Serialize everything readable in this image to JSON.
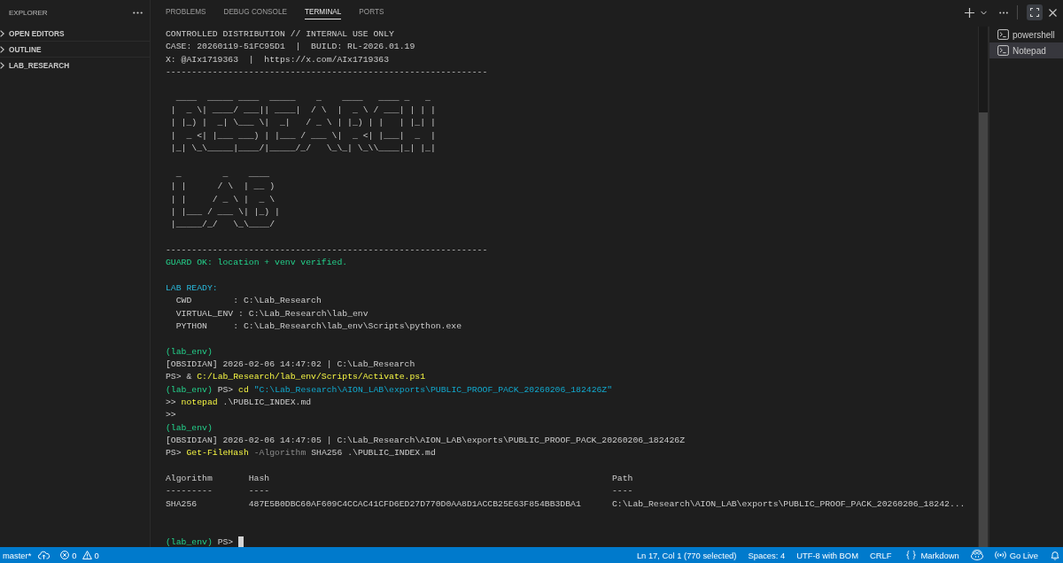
{
  "sidebar": {
    "title": "EXPLORER",
    "sections": [
      {
        "label": "OPEN EDITORS",
        "expanded": false
      },
      {
        "label": "OUTLINE",
        "expanded": false
      },
      {
        "label": "LAB_RESEARCH",
        "expanded": false
      }
    ]
  },
  "panel": {
    "tabs": [
      {
        "label": "PROBLEMS",
        "selected": false
      },
      {
        "label": "DEBUG CONSOLE",
        "selected": false
      },
      {
        "label": "TERMINAL",
        "selected": true
      },
      {
        "label": "PORTS",
        "selected": false
      }
    ]
  },
  "terminal": {
    "lines": [
      {
        "kind": "text",
        "segments": [
          {
            "kind": "plain",
            "text": "CONTROLLED DISTRIBUTION // INTERNAL USE ONLY"
          }
        ]
      },
      {
        "kind": "text",
        "segments": [
          {
            "kind": "plain",
            "text": "CASE: 20260119-51FC95D1  |  BUILD: RL-2026.01.19"
          }
        ]
      },
      {
        "kind": "text",
        "segments": [
          {
            "kind": "plain",
            "text": "X: @AIx1719363  |  https://x.com/AIx1719363"
          }
        ]
      },
      {
        "kind": "text",
        "segments": [
          {
            "kind": "plain",
            "text": "--------------------------------------------------------------"
          }
        ]
      },
      {
        "kind": "blank"
      },
      {
        "kind": "banner",
        "art": [
          " ____  _____ ____  _____    _    ____   ____ _   _",
          "|  _ \\| ____/ ___|| ____|  / \\  |  _ \\ / ___| | | |",
          "| |_) |  _| \\___ \\|  _|   / _ \\ | |_) | |   | |_| |",
          "|  _ <| |___ ___) | |___ / ___ \\|  _ <| |___|  _  |",
          "|_| \\_\\_____|____/|_____/_/   \\_\\_| \\_\\\\____|_| |_|"
        ]
      },
      {
        "kind": "blank"
      },
      {
        "kind": "banner",
        "art": [
          " _        _    ____",
          "| |      / \\  | __ )",
          "| |     / _ \\ |  _ \\",
          "| |___ / ___ \\| |_) |",
          "|_____/_/   \\_\\____/"
        ]
      },
      {
        "kind": "blank"
      },
      {
        "kind": "text",
        "segments": [
          {
            "kind": "plain",
            "text": "--------------------------------------------------------------"
          }
        ]
      },
      {
        "kind": "text",
        "segments": [
          {
            "kind": "success",
            "text": "GUARD OK: location + venv verified."
          }
        ]
      },
      {
        "kind": "blank"
      },
      {
        "kind": "text",
        "segments": [
          {
            "kind": "heading",
            "text": "LAB READY:"
          }
        ]
      },
      {
        "kind": "text",
        "segments": [
          {
            "kind": "plain",
            "text": "  CWD        : C:\\Lab_Research"
          }
        ]
      },
      {
        "kind": "text",
        "segments": [
          {
            "kind": "plain",
            "text": "  VIRTUAL_ENV : C:\\Lab_Research\\lab_env"
          }
        ]
      },
      {
        "kind": "text",
        "segments": [
          {
            "kind": "plain",
            "text": "  PYTHON     : C:\\Lab_Research\\lab_env\\Scripts\\python.exe"
          }
        ]
      },
      {
        "kind": "blank"
      },
      {
        "kind": "text",
        "segments": [
          {
            "kind": "success",
            "text": "(lab_env)"
          }
        ]
      },
      {
        "kind": "text",
        "segments": [
          {
            "kind": "plain",
            "text": "[OBSIDIAN] 2026-02-06 14:47:02 | C:\\Lab_Research"
          }
        ]
      },
      {
        "kind": "text",
        "segments": [
          {
            "kind": "plain",
            "text": "PS> & "
          },
          {
            "kind": "command",
            "text": "C:/Lab_Research/lab_env/Scripts/Activate.ps1"
          }
        ]
      },
      {
        "kind": "text",
        "segments": [
          {
            "kind": "success",
            "text": "(lab_env)"
          },
          {
            "kind": "plain",
            "text": " PS> "
          },
          {
            "kind": "command",
            "text": "cd"
          },
          {
            "kind": "string",
            "text": " \"C:\\Lab_Research\\AION_LAB\\exports\\PUBLIC_PROOF_PACK_20260206_182426Z\""
          }
        ]
      },
      {
        "kind": "text",
        "segments": [
          {
            "kind": "plain",
            "text": ">> "
          },
          {
            "kind": "command",
            "text": "notepad"
          },
          {
            "kind": "plain",
            "text": " .\\PUBLIC_INDEX.md"
          }
        ]
      },
      {
        "kind": "text",
        "segments": [
          {
            "kind": "plain",
            "text": ">>"
          }
        ]
      },
      {
        "kind": "text",
        "segments": [
          {
            "kind": "success",
            "text": "(lab_env)"
          }
        ]
      },
      {
        "kind": "text",
        "segments": [
          {
            "kind": "plain",
            "text": "[OBSIDIAN] 2026-02-06 14:47:05 | C:\\Lab_Research\\AION_LAB\\exports\\PUBLIC_PROOF_PACK_20260206_182426Z"
          }
        ]
      },
      {
        "kind": "text",
        "segments": [
          {
            "kind": "plain",
            "text": "PS> "
          },
          {
            "kind": "command",
            "text": "Get-FileHash"
          },
          {
            "kind": "parameter",
            "text": " -Algorithm"
          },
          {
            "kind": "plain",
            "text": " SHA256 .\\PUBLIC_INDEX.md"
          }
        ]
      },
      {
        "kind": "blank"
      },
      {
        "kind": "table",
        "columns": [
          {
            "header": "Algorithm",
            "rule": "---------"
          },
          {
            "header": "Hash",
            "rule": "----"
          },
          {
            "header": "Path",
            "rule": "----"
          }
        ],
        "rows": [
          [
            "SHA256",
            "487E5B0DBC60AF609C4CCAC41CFD6ED27D770D0AA8D1ACCB25E63F854BB3DBA1",
            "C:\\Lab_Research\\AION_LAB\\exports\\PUBLIC_PROOF_PACK_20260206_18242..."
          ]
        ]
      },
      {
        "kind": "blank"
      },
      {
        "kind": "blank"
      }
    ],
    "prompt": {
      "segments": [
        {
          "kind": "success",
          "text": "(lab_env)"
        },
        {
          "kind": "plain",
          "text": " PS> "
        }
      ],
      "cursor": true
    }
  },
  "terminal_list": [
    {
      "label": "powershell",
      "selected": false
    },
    {
      "label": "Notepad",
      "selected": true
    }
  ],
  "status_bar": {
    "branch": "master*",
    "errors": "0",
    "warnings": "0",
    "items": [
      "Ln 17, Col 1 (770 selected)",
      "Spaces: 4",
      "UTF-8 with BOM",
      "CRLF"
    ],
    "language": "Markdown",
    "live": "Go Live"
  }
}
